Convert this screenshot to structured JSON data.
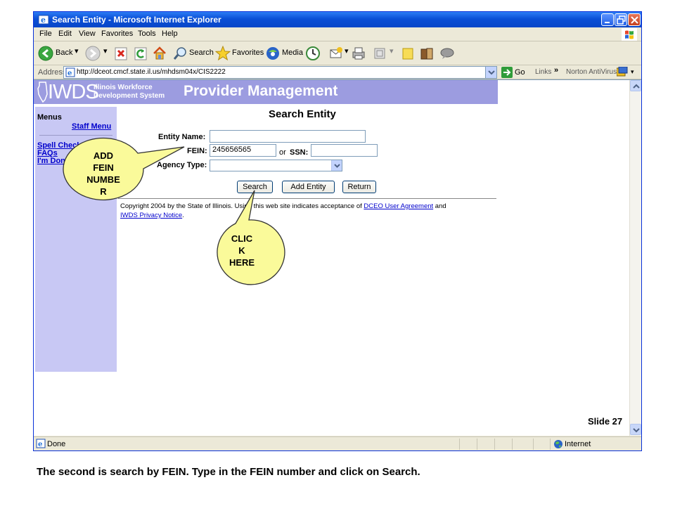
{
  "window": {
    "title": "Search Entity - Microsoft Internet Explorer",
    "menu": [
      "File",
      "Edit",
      "View",
      "Favorites",
      "Tools",
      "Help"
    ],
    "toolbar": {
      "back_label": "Back",
      "search_label": "Search",
      "favorites_label": "Favorites",
      "media_label": "Media"
    },
    "address": {
      "label": "Address",
      "url": "http://dceot.cmcf.state.il.us/mhdsm04x/CIS2222",
      "go_label": "Go",
      "links_label": "Links",
      "links_chevron": "»",
      "norton_label": "Norton AntiVirus"
    },
    "status": {
      "text": "Done",
      "zone": "Internet"
    }
  },
  "page": {
    "header": {
      "logo": "IWDS",
      "subtitle_line1": "Illinois Workforce",
      "subtitle_line2": "Development System",
      "title": "Provider Management"
    },
    "sidebar": {
      "heading": "Menus",
      "staff_menu": "Staff Menu",
      "links": [
        "Spell Check",
        "FAQs",
        "I'm Done"
      ]
    },
    "form": {
      "title": "Search Entity",
      "entity_name_label": "Entity Name:",
      "entity_name_value": "",
      "fein_label": "FEIN:",
      "fein_value": "245656565",
      "or_ssn_prefix": "or",
      "ssn_label": "SSN:",
      "ssn_value": "",
      "agency_type_label": "Agency Type:",
      "agency_type_value": "",
      "buttons": {
        "search": "Search",
        "add_entity": "Add Entity",
        "return": "Return"
      }
    },
    "footer": {
      "copyright_lead": "Copyright 2004 by the State of Illinois. Using this web site indicates acceptance of",
      "dceo_link": "DCEO User Agreement",
      "and_word": "and",
      "privacy_link": "IWDS Privacy Notice",
      "period": "."
    }
  },
  "annotations": {
    "fein_callout": [
      "ADD",
      "FEIN",
      "NUMBE",
      "R"
    ],
    "search_callout": [
      "CLIC",
      "K",
      "HERE"
    ],
    "callout_color": "#fafa9a",
    "slide_number": "Slide 27",
    "caption": "The second is search by FEIN.  Type in the FEIN number and click on Search."
  }
}
